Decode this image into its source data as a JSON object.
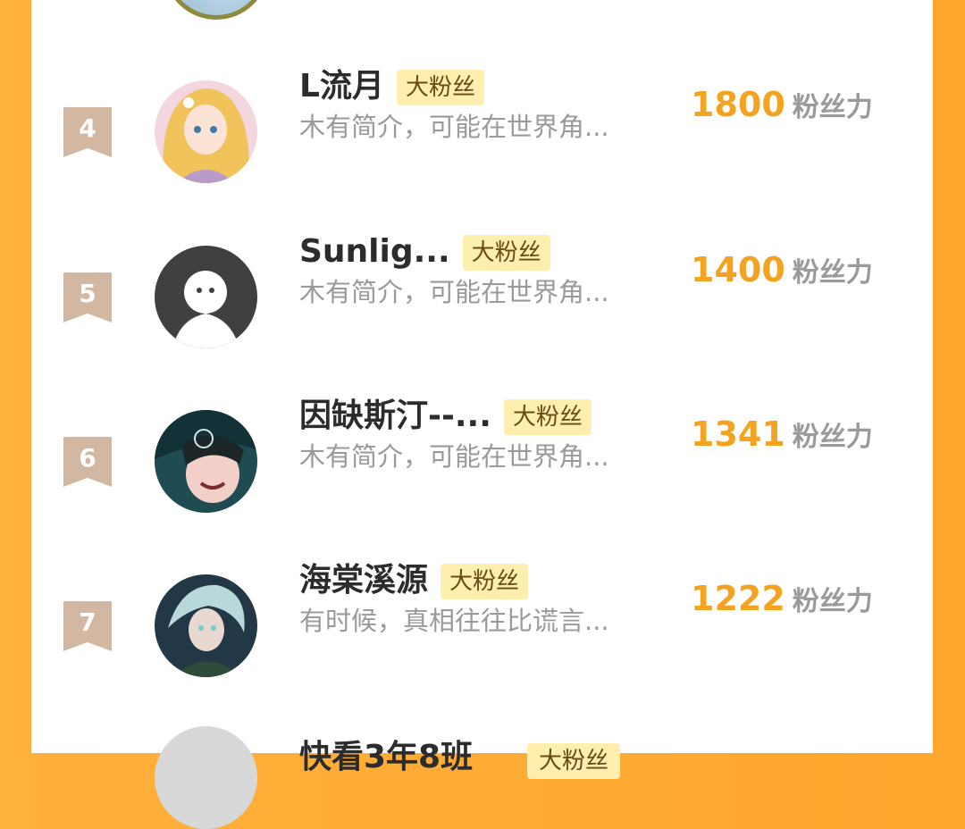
{
  "entries": [
    {
      "rank": "4",
      "name": "L流月",
      "badge": "大粉丝",
      "bio": "木有简介，可能在世界角...",
      "score": "1800",
      "unit": "粉丝力"
    },
    {
      "rank": "5",
      "name": "Sunlig...",
      "badge": "大粉丝",
      "bio": "木有简介，可能在世界角...",
      "score": "1400",
      "unit": "粉丝力"
    },
    {
      "rank": "6",
      "name": "因缺斯汀--...",
      "badge": "大粉丝",
      "bio": "木有简介，可能在世界角...",
      "score": "1341",
      "unit": "粉丝力"
    },
    {
      "rank": "7",
      "name": "海棠溪源",
      "badge": "大粉丝",
      "bio": "有时候，真相往往比谎言...",
      "score": "1222",
      "unit": "粉丝力"
    }
  ],
  "next_entry": {
    "name": "快看3年8班",
    "badge": "大粉丝"
  },
  "colors": {
    "background": "#ffa62c",
    "score": "#f4a321",
    "badge_bg": "#ffefae",
    "rank_ribbon": "#d2b7a3"
  }
}
